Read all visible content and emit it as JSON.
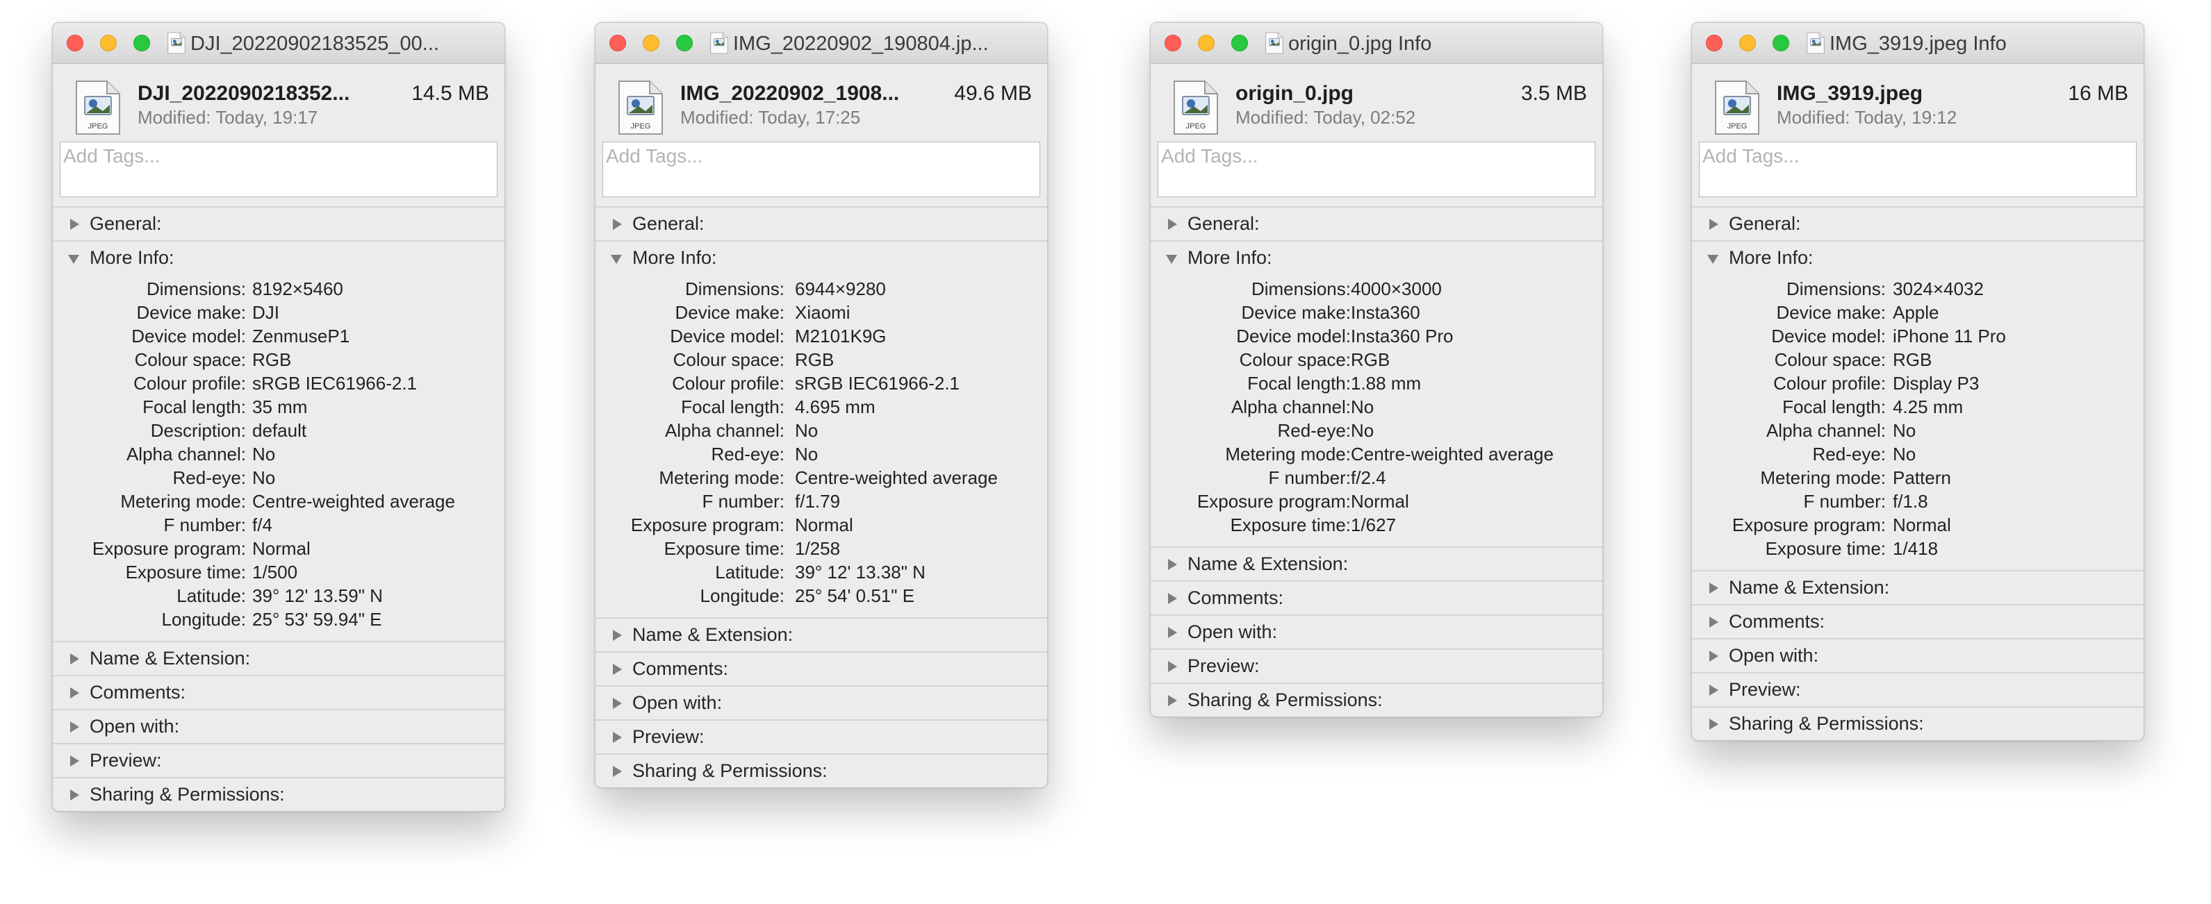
{
  "add_tags_placeholder": "Add Tags...",
  "windows": [
    {
      "title": "DJI_20220902183525_00...",
      "name": "DJI_2022090218352...",
      "size": "14.5 MB",
      "modified": "Modified: Today, 19:17",
      "sections": {
        "general": "General:",
        "more_info": "More Info:",
        "name_ext": "Name & Extension:",
        "comments": "Comments:",
        "open_with": "Open with:",
        "preview": "Preview:",
        "sharing": "Sharing & Permissions:"
      },
      "info": [
        {
          "k": "Dimensions:",
          "v": "8192×5460"
        },
        {
          "k": "Device make:",
          "v": "DJI"
        },
        {
          "k": "Device model:",
          "v": "ZenmuseP1"
        },
        {
          "k": "Colour space:",
          "v": "RGB"
        },
        {
          "k": "Colour profile:",
          "v": "sRGB IEC61966-2.1"
        },
        {
          "k": "Focal length:",
          "v": "35 mm"
        },
        {
          "k": "Description:",
          "v": "default"
        },
        {
          "k": "Alpha channel:",
          "v": "No"
        },
        {
          "k": "Red-eye:",
          "v": "No"
        },
        {
          "k": "Metering mode:",
          "v": "Centre-weighted average"
        },
        {
          "k": "F number:",
          "v": "f/4"
        },
        {
          "k": "Exposure program:",
          "v": "Normal"
        },
        {
          "k": "Exposure time:",
          "v": "1/500"
        },
        {
          "k": "Latitude:",
          "v": "39° 12' 13.59\" N"
        },
        {
          "k": "Longitude:",
          "v": "25° 53' 59.94\" E"
        }
      ]
    },
    {
      "title": "IMG_20220902_190804.jp...",
      "name": "IMG_20220902_1908...",
      "size": "49.6 MB",
      "modified": "Modified: Today, 17:25",
      "sections": {
        "general": "General:",
        "more_info": "More Info:",
        "name_ext": "Name & Extension:",
        "comments": "Comments:",
        "open_with": "Open with:",
        "preview": "Preview:",
        "sharing": "Sharing & Permissions:"
      },
      "info": [
        {
          "k": "Dimensions:",
          "v": "6944×9280"
        },
        {
          "k": "Device make:",
          "v": "Xiaomi"
        },
        {
          "k": "Device model:",
          "v": "M2101K9G"
        },
        {
          "k": "Colour space:",
          "v": "RGB"
        },
        {
          "k": "Colour profile:",
          "v": "sRGB IEC61966-2.1"
        },
        {
          "k": "Focal length:",
          "v": "4.695 mm"
        },
        {
          "k": "Alpha channel:",
          "v": "No"
        },
        {
          "k": "Red-eye:",
          "v": "No"
        },
        {
          "k": "Metering mode:",
          "v": "Centre-weighted average"
        },
        {
          "k": "F number:",
          "v": "f/1.79"
        },
        {
          "k": "Exposure program:",
          "v": "Normal"
        },
        {
          "k": "Exposure time:",
          "v": "1/258"
        },
        {
          "k": "Latitude:",
          "v": "39° 12' 13.38\" N"
        },
        {
          "k": "Longitude:",
          "v": "25° 54' 0.51\" E"
        }
      ]
    },
    {
      "title": "origin_0.jpg Info",
      "name": "origin_0.jpg",
      "size": "3.5 MB",
      "modified": "Modified: Today, 02:52",
      "sections": {
        "general": "General:",
        "more_info": "More Info:",
        "name_ext": "Name & Extension:",
        "comments": "Comments:",
        "open_with": "Open with:",
        "preview": "Preview:",
        "sharing": "Sharing & Permissions:"
      },
      "info": [
        {
          "k": "Dimensions:",
          "v": "4000×3000"
        },
        {
          "k": "Device make:",
          "v": "Insta360"
        },
        {
          "k": "Device model:",
          "v": "Insta360 Pro"
        },
        {
          "k": "Colour space:",
          "v": "RGB"
        },
        {
          "k": "Focal length:",
          "v": "1.88 mm"
        },
        {
          "k": "Alpha channel:",
          "v": "No"
        },
        {
          "k": "Red-eye:",
          "v": "No"
        },
        {
          "k": "Metering mode:",
          "v": "Centre-weighted average"
        },
        {
          "k": "F number:",
          "v": "f/2.4"
        },
        {
          "k": "Exposure program:",
          "v": "Normal"
        },
        {
          "k": "Exposure time:",
          "v": "1/627"
        }
      ]
    },
    {
      "title": "IMG_3919.jpeg Info",
      "name": "IMG_3919.jpeg",
      "size": "16 MB",
      "modified": "Modified: Today, 19:12",
      "sections": {
        "general": "General:",
        "more_info": "More Info:",
        "name_ext": "Name & Extension:",
        "comments": "Comments:",
        "open_with": "Open with:",
        "preview": "Preview:",
        "sharing": "Sharing & Permissions:"
      },
      "info": [
        {
          "k": "Dimensions:",
          "v": "3024×4032"
        },
        {
          "k": "Device make:",
          "v": "Apple"
        },
        {
          "k": "Device model:",
          "v": "iPhone 11 Pro"
        },
        {
          "k": "Colour space:",
          "v": "RGB"
        },
        {
          "k": "Colour profile:",
          "v": "Display P3"
        },
        {
          "k": "Focal length:",
          "v": "4.25 mm"
        },
        {
          "k": "Alpha channel:",
          "v": "No"
        },
        {
          "k": "Red-eye:",
          "v": "No"
        },
        {
          "k": "Metering mode:",
          "v": "Pattern"
        },
        {
          "k": "F number:",
          "v": "f/1.8"
        },
        {
          "k": "Exposure program:",
          "v": "Normal"
        },
        {
          "k": "Exposure time:",
          "v": "1/418"
        }
      ]
    }
  ],
  "icon_label": "JPEG",
  "colors": {
    "close": "#ff5f57",
    "minimize": "#febc2e",
    "maximize": "#28c840",
    "window_bg": "#ececec"
  }
}
